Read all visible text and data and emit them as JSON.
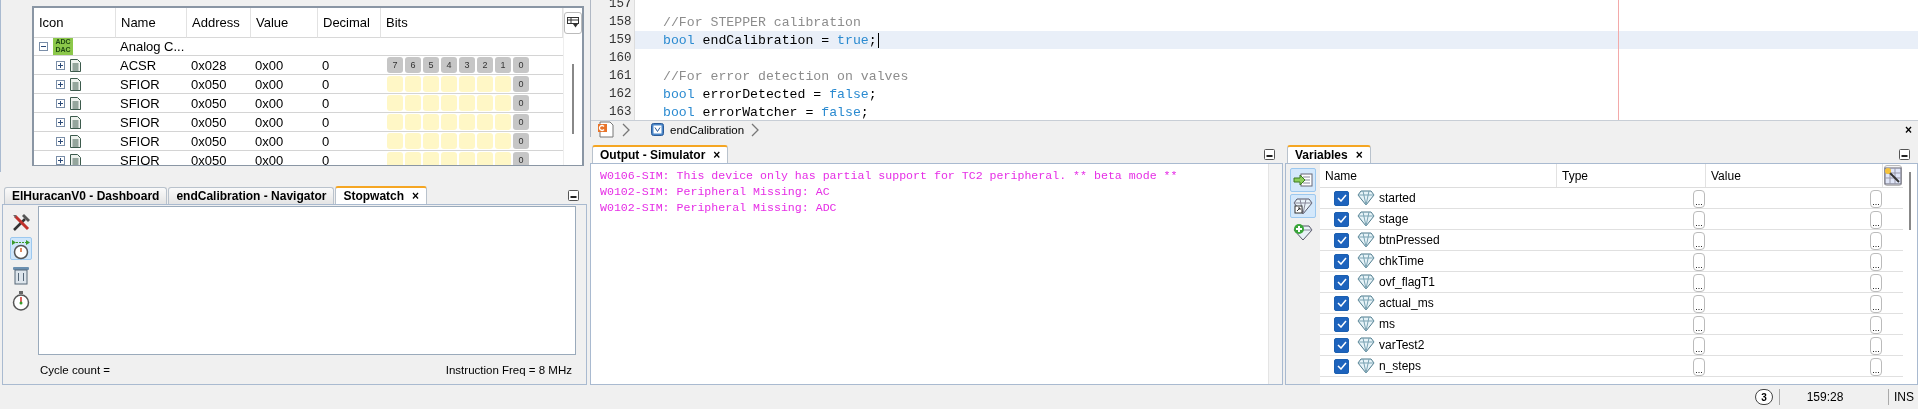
{
  "registers": {
    "columns": [
      "Icon",
      "Name",
      "Address",
      "Value",
      "Decimal",
      "Bits"
    ],
    "group": {
      "name": "Analog C...",
      "badge_lines": [
        "ADC",
        "DAC"
      ],
      "expanded": true,
      "rows": [
        {
          "name": "ACSR",
          "address": "0x028",
          "value": "0x00",
          "decimal": "0",
          "expanded": false,
          "bits": [
            {
              "kind": "labeled",
              "label": "7"
            },
            {
              "kind": "labeled",
              "label": "6"
            },
            {
              "kind": "labeled",
              "label": "5"
            },
            {
              "kind": "labeled",
              "label": "4"
            },
            {
              "kind": "labeled",
              "label": "3"
            },
            {
              "kind": "labeled",
              "label": "2"
            },
            {
              "kind": "labeled",
              "label": "1"
            },
            {
              "kind": "labeled",
              "label": "0"
            }
          ]
        },
        {
          "name": "SFIOR",
          "address": "0x050",
          "value": "0x00",
          "decimal": "0",
          "expanded": false,
          "bits": [
            {
              "kind": "blank"
            },
            {
              "kind": "blank"
            },
            {
              "kind": "blank"
            },
            {
              "kind": "blank"
            },
            {
              "kind": "blank"
            },
            {
              "kind": "blank"
            },
            {
              "kind": "blank"
            },
            {
              "kind": "labeled",
              "label": "0"
            }
          ]
        },
        {
          "name": "SFIOR",
          "address": "0x050",
          "value": "0x00",
          "decimal": "0",
          "expanded": false,
          "bits": [
            {
              "kind": "blank"
            },
            {
              "kind": "blank"
            },
            {
              "kind": "blank"
            },
            {
              "kind": "blank"
            },
            {
              "kind": "blank"
            },
            {
              "kind": "blank"
            },
            {
              "kind": "blank"
            },
            {
              "kind": "labeled",
              "label": "0"
            }
          ]
        },
        {
          "name": "SFIOR",
          "address": "0x050",
          "value": "0x00",
          "decimal": "0",
          "expanded": false,
          "bits": [
            {
              "kind": "blank"
            },
            {
              "kind": "blank"
            },
            {
              "kind": "blank"
            },
            {
              "kind": "blank"
            },
            {
              "kind": "blank"
            },
            {
              "kind": "blank"
            },
            {
              "kind": "blank"
            },
            {
              "kind": "labeled",
              "label": "0"
            }
          ]
        },
        {
          "name": "SFIOR",
          "address": "0x050",
          "value": "0x00",
          "decimal": "0",
          "expanded": false,
          "bits": [
            {
              "kind": "blank"
            },
            {
              "kind": "blank"
            },
            {
              "kind": "blank"
            },
            {
              "kind": "blank"
            },
            {
              "kind": "blank"
            },
            {
              "kind": "blank"
            },
            {
              "kind": "blank"
            },
            {
              "kind": "labeled",
              "label": "0"
            }
          ]
        },
        {
          "name": "SFIOR",
          "address": "0x050",
          "value": "0x00",
          "decimal": "0",
          "expanded": false,
          "bits": [
            {
              "kind": "blank"
            },
            {
              "kind": "blank"
            },
            {
              "kind": "blank"
            },
            {
              "kind": "blank"
            },
            {
              "kind": "blank"
            },
            {
              "kind": "blank"
            },
            {
              "kind": "blank"
            },
            {
              "kind": "labeled",
              "label": "0"
            }
          ]
        }
      ]
    }
  },
  "stopwatch_tabs": [
    {
      "label": "ElHuracanV0 - Dashboard",
      "selected": false
    },
    {
      "label": "endCalibration - Navigator",
      "selected": false
    },
    {
      "label": "Stopwatch",
      "selected": true,
      "close": "×"
    }
  ],
  "stopwatch": {
    "tools": [
      {
        "kind": "tools",
        "selected": false
      },
      {
        "kind": "reset",
        "selected": true
      },
      {
        "kind": "trash",
        "selected": false
      },
      {
        "kind": "stopwatch",
        "selected": false
      }
    ],
    "cycle_count": "Cycle count =",
    "instruction_freq": "Instruction Freq = 8 MHz"
  },
  "editor": {
    "lines": [
      {
        "number": "157",
        "current": false
      },
      {
        "number": "158",
        "current": false,
        "tokens": [
          {
            "kind": "comment",
            "text": "//For STEPPER calibration"
          }
        ]
      },
      {
        "number": "159",
        "current": true,
        "tokens": [
          {
            "kind": "keyword",
            "text": "bool"
          },
          {
            "kind": "plain",
            "text": " endCalibration = "
          },
          {
            "kind": "keyword",
            "text": "true"
          },
          {
            "kind": "plain",
            "text": ";"
          }
        ]
      },
      {
        "number": "160",
        "current": false
      },
      {
        "number": "161",
        "current": false,
        "tokens": [
          {
            "kind": "comment",
            "text": "//For error detection on valves"
          }
        ]
      },
      {
        "number": "162",
        "current": false,
        "tokens": [
          {
            "kind": "keyword",
            "text": "bool"
          },
          {
            "kind": "plain",
            "text": " errorDetected = "
          },
          {
            "kind": "keyword",
            "text": "false"
          },
          {
            "kind": "plain",
            "text": ";"
          }
        ]
      },
      {
        "number": "163",
        "current": false,
        "tokens": [
          {
            "kind": "keyword",
            "text": "bool"
          },
          {
            "kind": "plain",
            "text": " errorWatcher = "
          },
          {
            "kind": "keyword",
            "text": "false"
          },
          {
            "kind": "plain",
            "text": ";"
          }
        ]
      }
    ],
    "breadcrumb": {
      "label": "endCalibration",
      "close": "×"
    }
  },
  "output": {
    "tab": {
      "label": "Output - Simulator",
      "selected": true,
      "close": "×"
    },
    "lines": [
      "W0106-SIM: This device only has partial support for TC2 peripheral. ** beta mode **",
      "W0102-SIM: Peripheral Missing: AC",
      "W0102-SIM: Peripheral Missing: ADC"
    ]
  },
  "variables": {
    "tab": {
      "label": "Variables",
      "selected": true,
      "close": "×"
    },
    "tools": [
      {
        "kind": "add-watch",
        "selected": true
      },
      {
        "kind": "new-watch",
        "selected": true
      },
      {
        "kind": "add-variable",
        "selected": false
      }
    ],
    "columns": [
      "Name",
      "Type",
      "Value"
    ],
    "rows": [
      {
        "name": "started",
        "checked": true,
        "type_button": "...",
        "value_button": "..."
      },
      {
        "name": "stage",
        "checked": true,
        "type_button": "...",
        "value_button": "..."
      },
      {
        "name": "btnPressed",
        "checked": true,
        "type_button": "...",
        "value_button": "..."
      },
      {
        "name": "chkTime",
        "checked": true,
        "type_button": "...",
        "value_button": "..."
      },
      {
        "name": "ovf_flagT1",
        "checked": true,
        "type_button": "...",
        "value_button": "..."
      },
      {
        "name": "actual_ms",
        "checked": true,
        "type_button": "...",
        "value_button": "..."
      },
      {
        "name": "ms",
        "checked": true,
        "type_button": "...",
        "value_button": "..."
      },
      {
        "name": "varTest2",
        "checked": true,
        "type_button": "...",
        "value_button": "..."
      },
      {
        "name": "n_steps",
        "checked": true,
        "type_button": "...",
        "value_button": "..."
      }
    ]
  },
  "status_bar": {
    "notifications": "3",
    "position": "159:28",
    "mode": "INS"
  }
}
